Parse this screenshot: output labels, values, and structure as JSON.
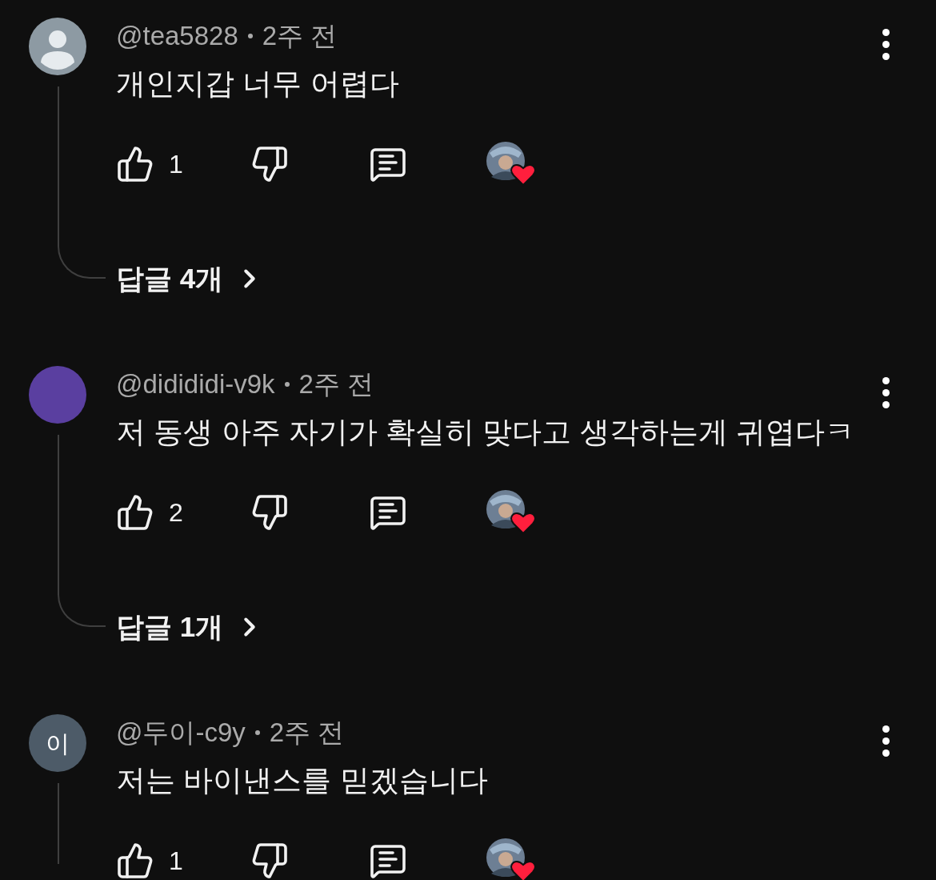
{
  "comments": [
    {
      "author": "@tea5828",
      "time": "2주 전",
      "text": "개인지갑 너무 어렵다",
      "likes": "1",
      "avatar": {
        "kind": "default"
      },
      "hearted": true,
      "replies": "답글 4개"
    },
    {
      "author": "@didididi-v9k",
      "time": "2주 전",
      "text": "저 동생 아주 자기가 확실히 맞다고 생각하는게 귀엽다ㅋ",
      "likes": "2",
      "avatar": {
        "kind": "color",
        "color": "#5a3fa0"
      },
      "hearted": true,
      "replies": "답글 1개"
    },
    {
      "author": "@두이-c9y",
      "time": "2주 전",
      "text": "저는 바이낸스를 믿겠습니다",
      "likes": "1",
      "avatar": {
        "kind": "letter",
        "letter": "이",
        "color": "#4d5b68"
      },
      "hearted": true
    }
  ]
}
